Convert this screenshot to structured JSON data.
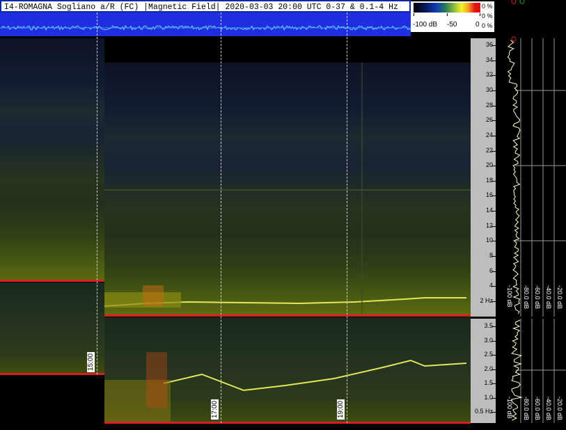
{
  "header": {
    "title": "I4-ROMAGNA  Sogliano a/R (FC) |Magnetic Field| 2020-03-03 20:00 UTC 0-37 & 0.1-4 Hz"
  },
  "palette": {
    "scale_min": "-100 dB",
    "scale_mid": "-50",
    "scale_max": "0",
    "pct_labels": [
      "0 %",
      "0 %",
      "0 %"
    ]
  },
  "top_axis": {
    "ticks": [
      "36",
      "34",
      "32",
      "30",
      "28",
      "26",
      "24",
      "22",
      "20",
      "18",
      "16",
      "14",
      "12",
      "10",
      "8",
      "6",
      "4",
      "2 Hz"
    ]
  },
  "bottom_axis": {
    "ticks": [
      "3.5",
      "3.0",
      "2.5",
      "2.0",
      "1.5",
      "1.0",
      "0.5 Hz"
    ]
  },
  "db_labels": [
    "-100 dB",
    "-80.0 dB",
    "-60.0 dB",
    "-40.0 dB",
    "-20.0 dB"
  ],
  "time_labels": [
    "15:00",
    "17:00",
    "19:00"
  ],
  "colors": {
    "header_border": "#0a2aa8",
    "waveform_bg": "#1f2fe0",
    "red_baseline": "#e01c1c",
    "scale_bg": "#bdbdbd"
  }
}
